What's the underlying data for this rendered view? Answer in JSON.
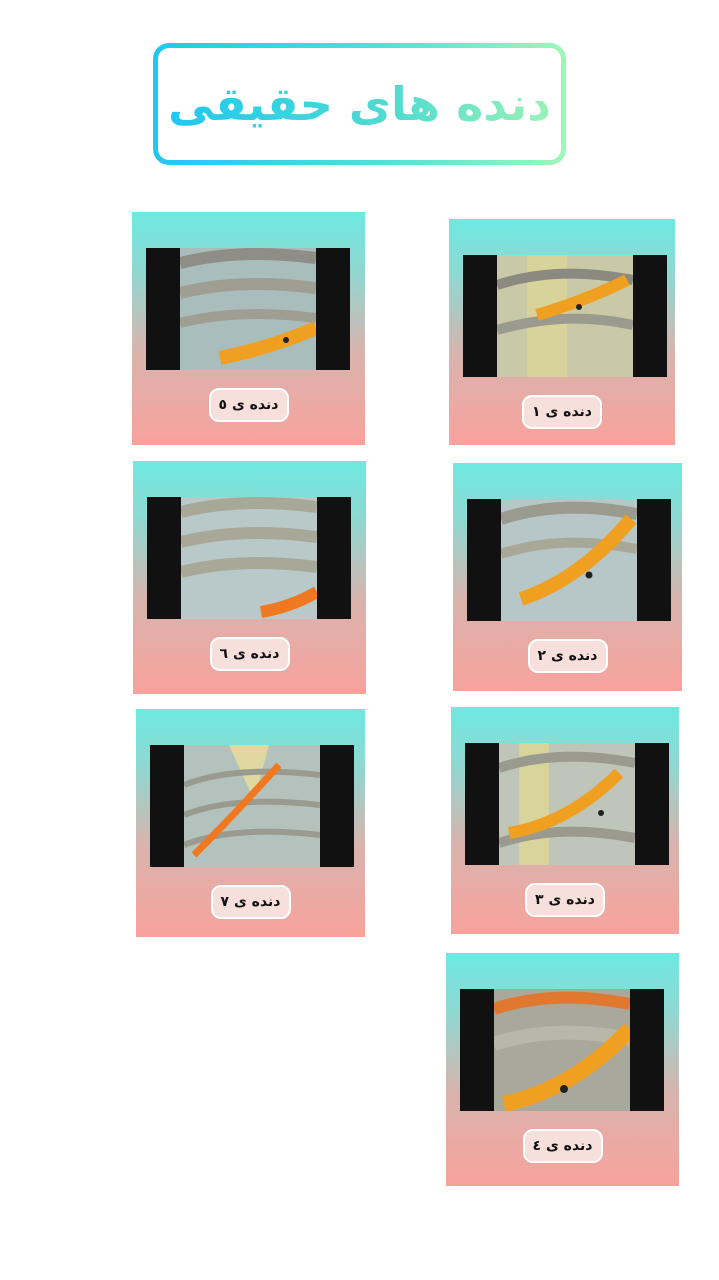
{
  "header": {
    "title": "دنده های حقیقی"
  },
  "cards": [
    {
      "label": "دنده ی ۱"
    },
    {
      "label": "دنده ی ۲"
    },
    {
      "label": "دنده ی ۳"
    },
    {
      "label": "دنده ی ٤"
    },
    {
      "label": "دنده ی ٥"
    },
    {
      "label": "دنده ی ٦"
    },
    {
      "label": "دنده ی ٧"
    }
  ],
  "colors": {
    "title_gradient_start": "#1ec8f0",
    "title_gradient_end": "#9ef7b8",
    "card_top": "#6de9e1",
    "card_bottom": "#f9a29c",
    "rib_highlight": "#f0a020"
  }
}
